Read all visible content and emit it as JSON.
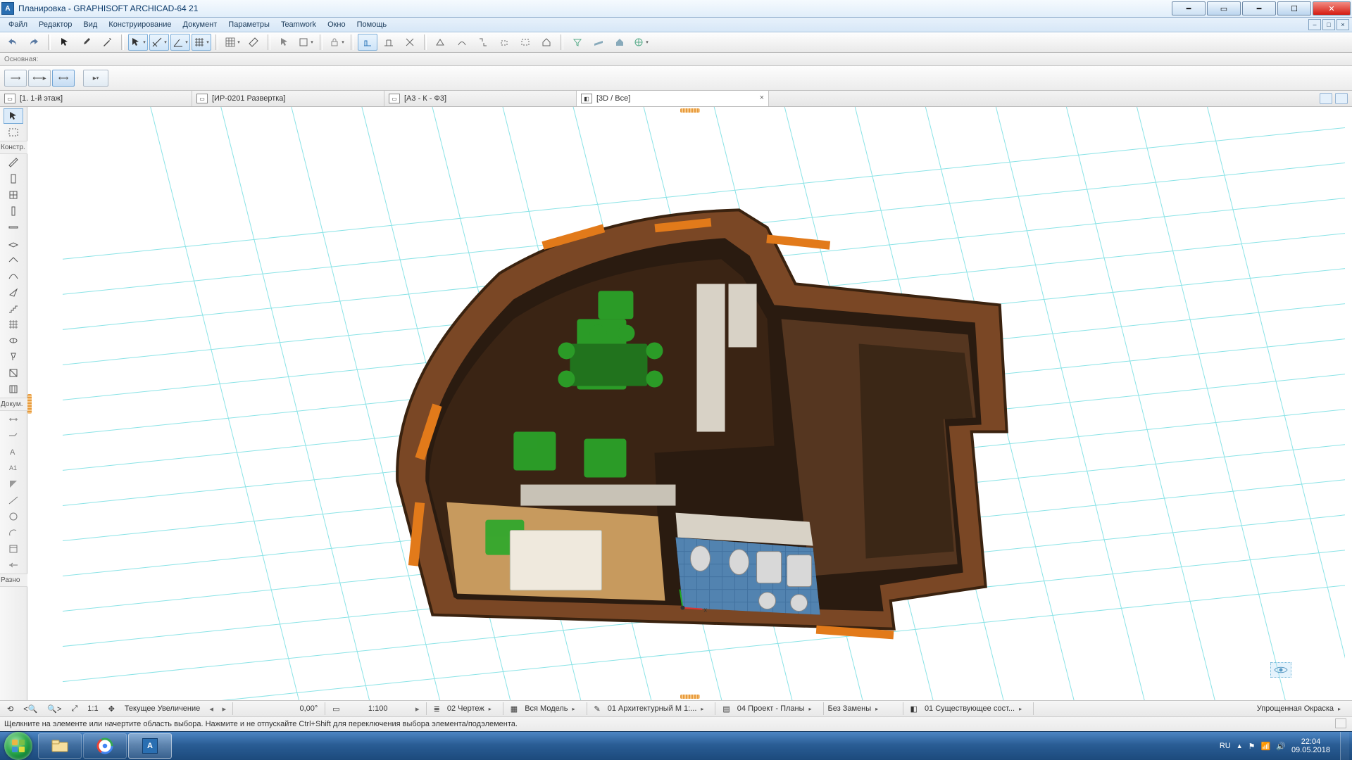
{
  "title": "Планировка - GRAPHISOFT ARCHICAD-64 21",
  "menu": [
    "Файл",
    "Редактор",
    "Вид",
    "Конструирование",
    "Документ",
    "Параметры",
    "Teamwork",
    "Окно",
    "Помощь"
  ],
  "info_label": "Основная:",
  "tabs": [
    {
      "label": "[1. 1-й этаж]",
      "active": false,
      "kind": "plan"
    },
    {
      "label": "[ИР-0201 Развертка]",
      "active": false,
      "kind": "sheet"
    },
    {
      "label": "[А3 - К - Ф3]",
      "active": false,
      "kind": "sheet"
    },
    {
      "label": "[3D / Все]",
      "active": true,
      "kind": "3d"
    }
  ],
  "toolbox": {
    "cat1": "Констр.",
    "cat2": "Докум.",
    "cat3": "Разно"
  },
  "quickbar": {
    "angle": "0,00°",
    "scale": "1:100",
    "zoom_label": "Текущее Увеличение",
    "drawing": "02 Чертеж",
    "model": "Вся Модель",
    "arch": "01 Архитектурный М 1:...",
    "project": "04 Проект - Планы",
    "replace": "Без Замены",
    "exist": "01 Существующее сост...",
    "shading": "Упрощенная Окраска"
  },
  "hint": "Щелкните на элементе или начертите область выбора. Нажмите и не отпускайте Ctrl+Shift для переключения выбора элемента/подэлемента.",
  "tray": {
    "lang": "RU",
    "time": "22:04",
    "date": "09.05.2018"
  }
}
